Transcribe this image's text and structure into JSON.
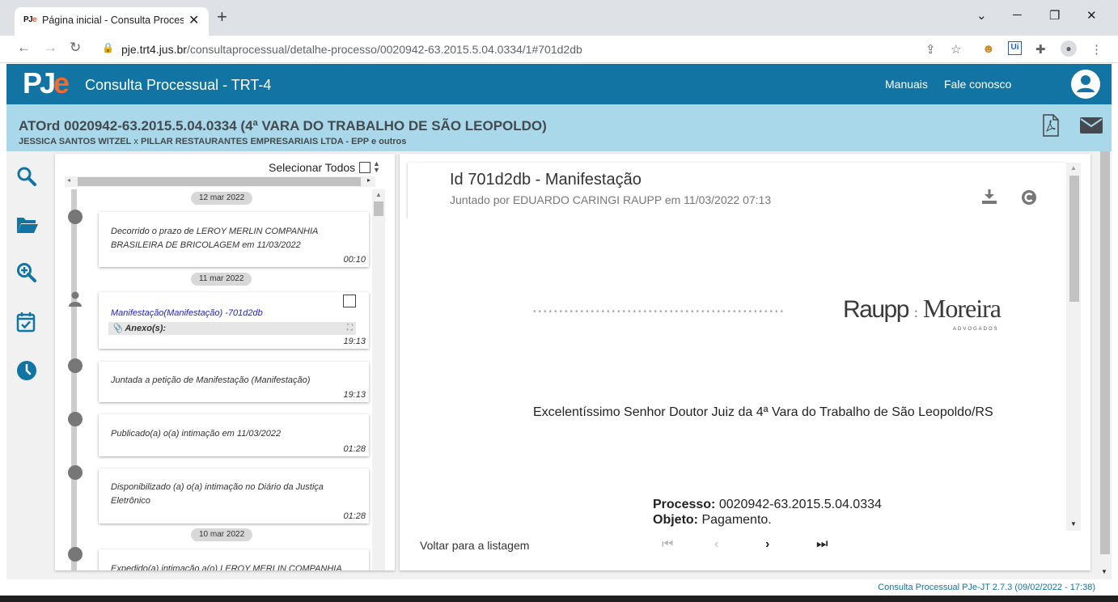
{
  "browser": {
    "tab_title": "Página inicial - Consulta Processu",
    "tab_favicon": "PJe",
    "url_host": "pje.trt4.jus.br",
    "url_path": "/consultaprocessual/detalhe-processo/0020942-63.2015.5.04.0334/1#701d2db"
  },
  "header": {
    "app_title": "Consulta Processual - TRT-4",
    "manuais": "Manuais",
    "fale_conosco": "Fale conosco",
    "brand_color": "#1174a2",
    "accent_color": "#f26b2a"
  },
  "process": {
    "title": "ATOrd 0020942-63.2015.5.04.0334 (4ª VARA DO TRABALHO DE SÃO LEOPOLDO)",
    "party_a": "JESSICA SANTOS WITZEL",
    "separator": "x",
    "party_b": "PILLAR RESTAURANTES EMPRESARIAIS LTDA - EPP e outros"
  },
  "timeline": {
    "select_all": "Selecionar Todos",
    "dates": [
      "12 mar 2022",
      "11 mar 2022",
      "10 mar 2022"
    ],
    "events": [
      {
        "text": "Decorrido o prazo de LEROY MERLIN COMPANHIA BRASILEIRA DE BRICOLAGEM em 11/03/2022",
        "time": "00:10"
      },
      {
        "link": "Manifestação(Manifestação) -701d2db",
        "attachment": "Anexo(s):",
        "time": "19:13"
      },
      {
        "text": "Juntada a petição de Manifestação (Manifestação)",
        "time": "19:13"
      },
      {
        "text": "Publicado(a) o(a) intimação em 11/03/2022",
        "time": "01:28"
      },
      {
        "text": "Disponibilizado (a) o(a) intimação no Diário da Justiça Eletrônico",
        "time": "01:28"
      },
      {
        "text": "Expedido(a) intimação a(o) LEROY MERLIN COMPANHIA",
        "time": ""
      }
    ]
  },
  "document": {
    "title": "Id 701d2db - Manifestação",
    "subtitle": "Juntado por EDUARDO CARINGI RAUPP em 11/03/2022 07:13",
    "logo_left": "Raupp",
    "logo_sep": ":",
    "logo_right": "Moreira",
    "logo_sub": "ADVOGADOS",
    "greeting": "Excelentíssimo Senhor Doutor Juiz da 4ª Vara do Trabalho de São Leopoldo/RS",
    "processo_label": "Processo:",
    "processo_value": " 0020942-63.2015.5.04.0334",
    "objeto_label": "Objeto:",
    "objeto_value": " Pagamento.",
    "back_link": "Voltar para a listagem"
  },
  "footer": {
    "version": "Consulta Processual PJe-JT 2.7.3 (09/02/2022 - 17:38)"
  }
}
